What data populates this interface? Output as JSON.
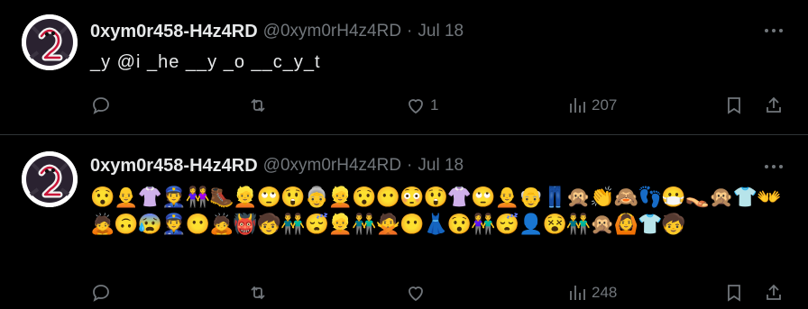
{
  "tweets": [
    {
      "name": "0xym0r458-H4z4RD",
      "handle": "@0xym0rH4z4RD",
      "separator": "·",
      "date": "Jul 18",
      "text": "_y @i _he __y _o __c_y_t",
      "likes": "1",
      "views": "207"
    },
    {
      "name": "0xym0r458-H4z4RD",
      "handle": "@0xym0rH4z4RD",
      "separator": "·",
      "date": "Jul 18",
      "text": "😯🧑‍🦲👚👮👭🥾👱🙄😲👵👱😯😶😳😲👚🙄🧑‍🦲👴👖🙊👏🙈👣😷👡🙊👕👐🙇🙃😰👮😶🙇👹🧒👬😴👱👬🙅😶👗😯👫😴👤😵👬🙊🙆👕🧒",
      "likes": "",
      "views": "248"
    }
  ],
  "icons": {
    "more": "more-horizontal-icon",
    "reply": "reply-icon",
    "retweet": "retweet-icon",
    "like": "heart-icon",
    "views": "views-bar-chart-icon",
    "bookmark": "bookmark-icon",
    "share": "share-icon"
  },
  "colors": {
    "background": "#000000",
    "text": "#e7e9ea",
    "muted": "#71767b",
    "divider": "#2f3336"
  }
}
